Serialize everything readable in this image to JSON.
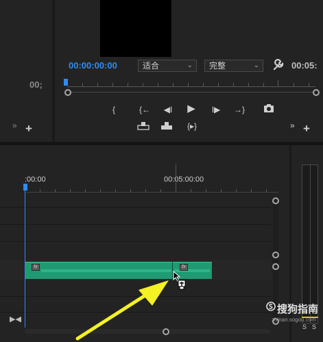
{
  "program_monitor": {
    "timecode": "00:00:00:00",
    "fit_select": "适合",
    "quality_select": "完整",
    "duration": "00:05:",
    "icons": [
      "wrench-icon",
      "mark-in-icon",
      "go-to-in-icon",
      "step-back-icon",
      "play-icon",
      "step-forward-icon",
      "go-to-out-icon",
      "export-frame-icon",
      "lift-icon",
      "extract-icon",
      "insert-icon",
      "more-icon",
      "add-icon"
    ]
  },
  "left_panel": {
    "timecode": "00;",
    "more": "»",
    "add": "+"
  },
  "timeline": {
    "ruler_start": ":00:00",
    "ruler_mark": "00:05:00:00",
    "clip_fx": "fx"
  },
  "audio_meter": {
    "solo_left": "S",
    "solo_right": "S"
  },
  "watermark": {
    "name": "搜狗指南",
    "url": "zhinan.sogou.com"
  },
  "colors": {
    "playhead": "#2f8bf2",
    "clip": "#1f9a72",
    "annotation": "#f4f125"
  }
}
